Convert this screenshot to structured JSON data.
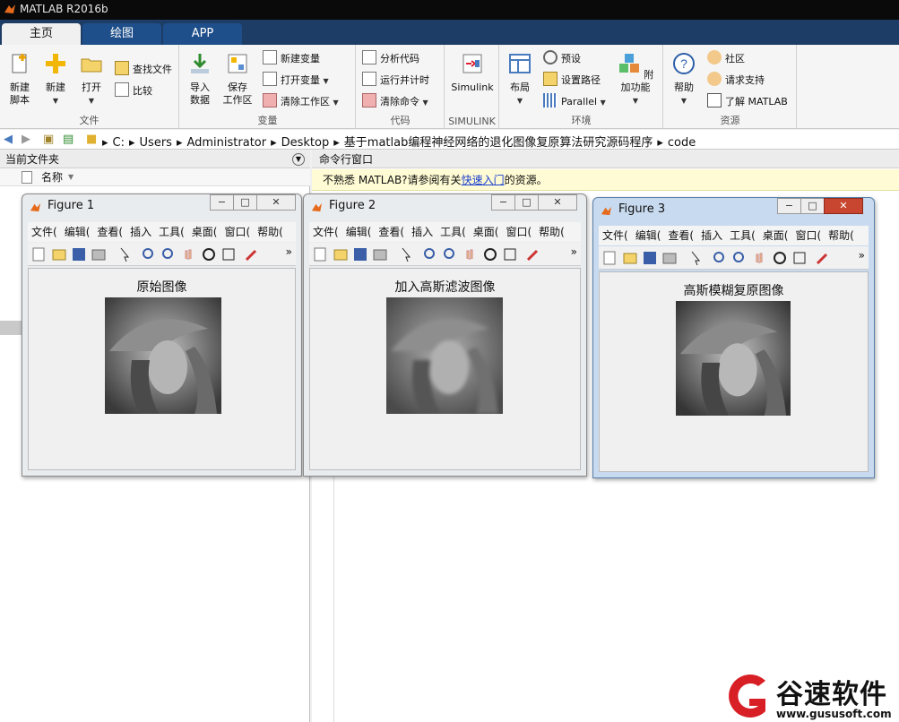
{
  "window": {
    "title": "MATLAB R2016b"
  },
  "tabs": [
    "主页",
    "绘图",
    "APP"
  ],
  "ribbon": {
    "file": {
      "label": "文件",
      "new_script": "新建\n脚本",
      "new": "新建",
      "open": "打开",
      "find_files": "查找文件",
      "compare": "比较"
    },
    "variable": {
      "label": "变量",
      "import": "导入\n数据",
      "save_ws": "保存\n工作区",
      "new_var": "新建变量",
      "open_var": "打开变量",
      "clear_ws": "清除工作区"
    },
    "code": {
      "label": "代码",
      "analyze": "分析代码",
      "run_time": "运行并计时",
      "clear_cmd": "清除命令"
    },
    "simulink": {
      "label": "SIMULINK",
      "simulink": "Simulink"
    },
    "env": {
      "label": "环境",
      "layout": "布局",
      "prefs": "预设",
      "set_path": "设置路径",
      "parallel": "Parallel",
      "addons": "附加功能"
    },
    "resources": {
      "label": "资源",
      "help": "帮助",
      "community": "社区",
      "support": "请求支持",
      "learn": "了解 MATLAB"
    }
  },
  "address": [
    "C:",
    "Users",
    "Administrator",
    "Desktop",
    "基于matlab编程神经网络的退化图像复原算法研究源码程序",
    "code"
  ],
  "left_pane": {
    "title": "当前文件夹",
    "column": "名称"
  },
  "right_pane": {
    "title": "命令行窗口",
    "notice_pre": "不熟悉 MATLAB?请参阅有关",
    "notice_link": "快速入门",
    "notice_post": "的资源。"
  },
  "figure_menu": [
    "文件(",
    "编辑(",
    "查看(",
    "插入",
    "工具(",
    "桌面(",
    "窗口(",
    "帮助("
  ],
  "figures": [
    {
      "title": "Figure 1",
      "plot_title": "原始图像"
    },
    {
      "title": "Figure 2",
      "plot_title": "加入高斯滤波图像"
    },
    {
      "title": "Figure 3",
      "plot_title": "高斯模糊复原图像"
    }
  ],
  "watermark": {
    "name": "谷速软件",
    "url": "www.gususoft.com"
  },
  "colors": {
    "accent": "#1d3c66",
    "active_tab": "#f0f0f0",
    "notice_bg": "#fffbd4"
  }
}
